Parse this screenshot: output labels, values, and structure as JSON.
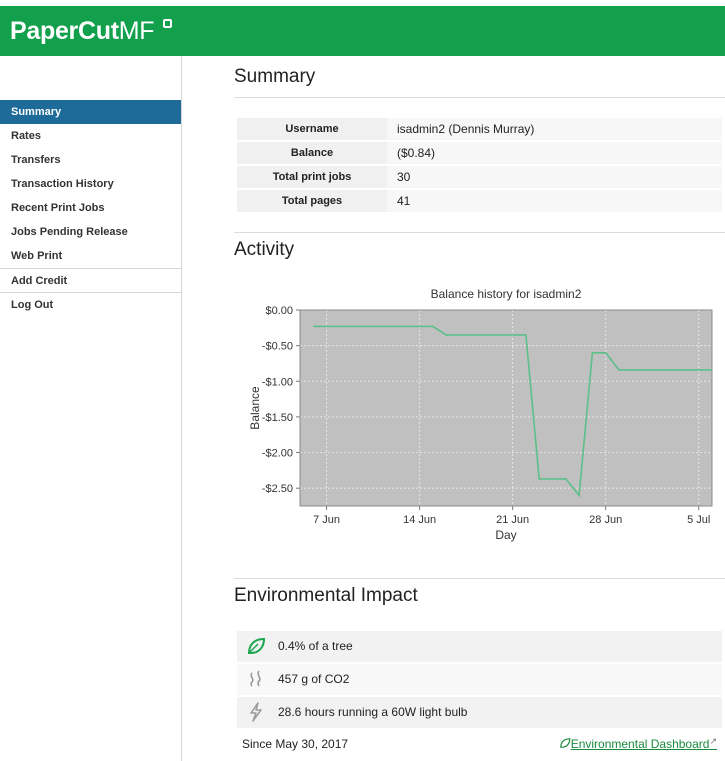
{
  "app": {
    "logo_main": "PaperCut",
    "logo_suffix": "MF"
  },
  "sidebar": {
    "items": [
      {
        "label": "Summary",
        "active": true
      },
      {
        "label": "Rates"
      },
      {
        "label": "Transfers"
      },
      {
        "label": "Transaction History"
      },
      {
        "label": "Recent Print Jobs"
      },
      {
        "label": "Jobs Pending Release"
      },
      {
        "label": "Web Print"
      },
      {
        "label": "Add Credit"
      },
      {
        "label": "Log Out"
      }
    ]
  },
  "summary": {
    "title": "Summary",
    "rows": [
      {
        "key": "Username",
        "value": "isadmin2 (Dennis Murray)"
      },
      {
        "key": "Balance",
        "value": "($0.84)"
      },
      {
        "key": "Total print jobs",
        "value": "30"
      },
      {
        "key": "Total pages",
        "value": "41"
      }
    ]
  },
  "activity": {
    "title": "Activity"
  },
  "chart_data": {
    "type": "line",
    "title": "Balance history for isadmin2",
    "xlabel": "Day",
    "ylabel": "Balance",
    "ylim": [
      -2.75,
      0
    ],
    "yticks": [
      0,
      -0.5,
      -1.0,
      -1.5,
      -2.0,
      -2.5
    ],
    "ytick_labels": [
      "$0.00",
      "-$0.50",
      "-$1.00",
      "-$1.50",
      "-$2.00",
      "-$2.50"
    ],
    "xlim": [
      "2017-06-05",
      "2017-07-06"
    ],
    "xticks": [
      "2017-06-07",
      "2017-06-14",
      "2017-06-21",
      "2017-06-28",
      "2017-07-05"
    ],
    "xtick_labels": [
      "7 Jun",
      "14 Jun",
      "21 Jun",
      "28 Jun",
      "5 Jul"
    ],
    "grid": true,
    "line_color": "#5bbf8a",
    "plot_bg": "#c0c0c0",
    "series": [
      {
        "x": [
          "2017-06-06",
          "2017-06-15",
          "2017-06-16",
          "2017-06-22",
          "2017-06-23",
          "2017-06-25",
          "2017-06-26",
          "2017-06-27",
          "2017-06-28",
          "2017-06-29",
          "2017-07-06"
        ],
        "y": [
          -0.23,
          -0.23,
          -0.35,
          -0.35,
          -2.37,
          -2.37,
          -2.6,
          -0.6,
          -0.6,
          -0.84,
          -0.84
        ]
      }
    ]
  },
  "environment": {
    "title": "Environmental Impact",
    "rows": [
      {
        "icon": "leaf-icon",
        "text": "0.4% of a tree"
      },
      {
        "icon": "co2-icon",
        "text": "457 g of CO2"
      },
      {
        "icon": "lightning-icon",
        "text": "28.6 hours running a 60W light bulb"
      }
    ],
    "since": "Since May 30, 2017",
    "dashboard_link": "Environmental Dashboard"
  },
  "colors": {
    "brand": "#12a04c",
    "nav_active": "#1e6b99",
    "link": "#1a8a3e"
  }
}
